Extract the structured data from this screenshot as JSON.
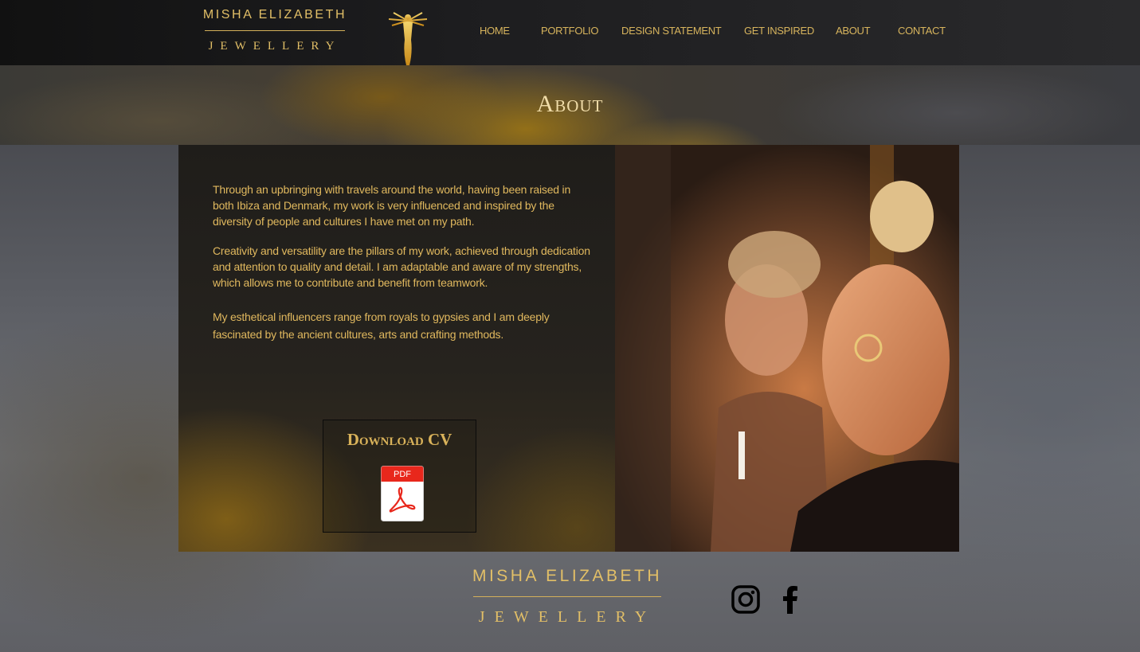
{
  "header": {
    "logo_top": "MISHA ELIZABETH",
    "logo_bottom": "JEWELLERY",
    "nav": [
      {
        "label": "HOME"
      },
      {
        "label": "PORTFOLIO"
      },
      {
        "label": "DESIGN STATEMENT"
      },
      {
        "label": "GET INSPIRED"
      },
      {
        "label": "ABOUT"
      },
      {
        "label": "CONTACT"
      }
    ]
  },
  "banner": {
    "title": "About"
  },
  "content": {
    "paragraphs": [
      "Through an upbringing with travels around the world, having been raised in both Ibiza and Denmark, my work is very influenced and inspired by the diversity of people and cultures I have met on my path.",
      "Creativity and versatility are the pillars of my work, achieved through dedication and attention to quality and detail. I am adaptable and aware of my strengths, which allows me to contribute and benefit from teamwork.",
      "My esthetical influencers range from royals to gypsies and I am deeply fascinated by the ancient cultures, arts and crafting methods."
    ],
    "cv_title": "Download CV",
    "pdf_label": "PDF"
  },
  "footer": {
    "logo_top": "MISHA ELIZABETH",
    "logo_bottom": "JEWELLERY",
    "social": [
      "instagram-icon",
      "facebook-icon"
    ]
  },
  "colors": {
    "gold": "#e0b85e",
    "header_bg": "#1d1d1f",
    "pdf_red": "#e8271c"
  }
}
